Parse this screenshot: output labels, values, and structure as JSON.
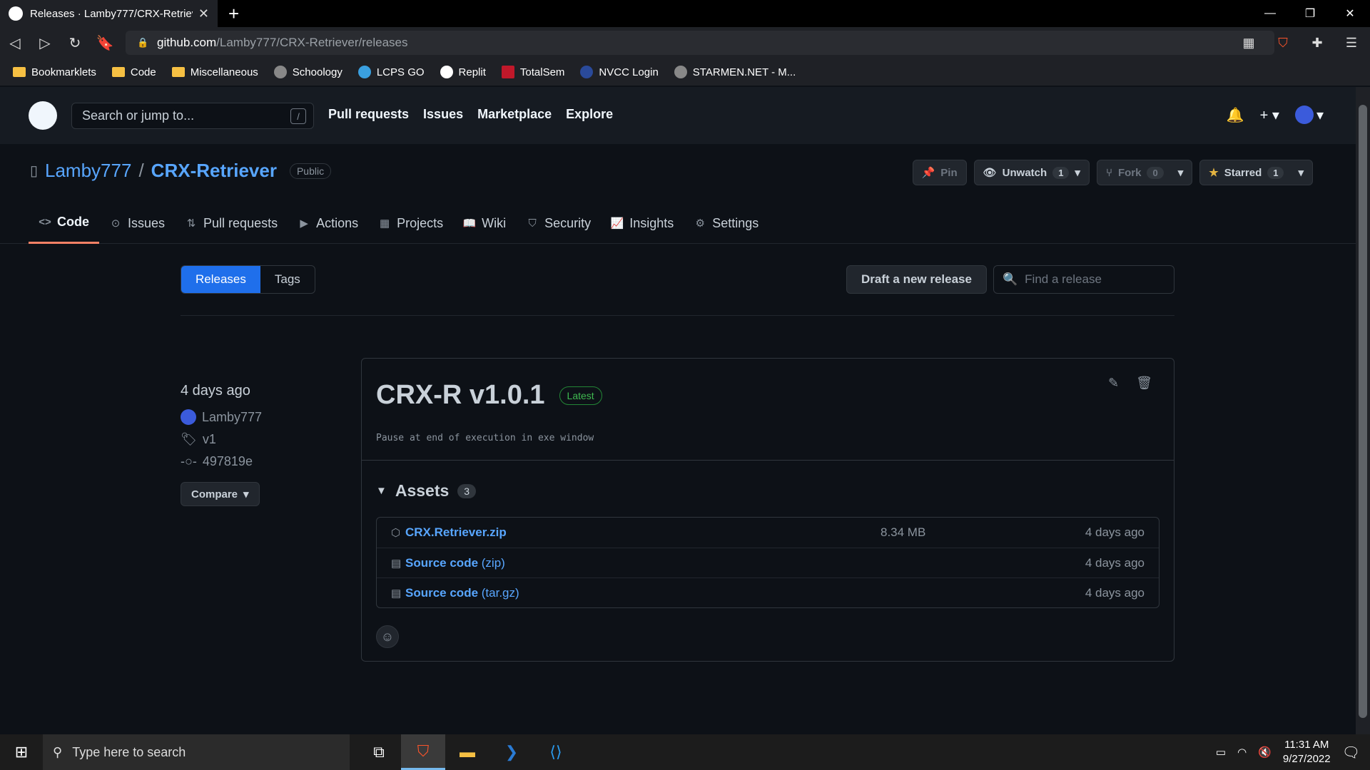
{
  "browser": {
    "tab_title": "Releases · Lamby777/CRX-Retriever",
    "url_host": "github.com",
    "url_path": "/Lamby777/CRX-Retriever/releases",
    "bookmarks": [
      "Bookmarklets",
      "Code",
      "Miscellaneous",
      "Schoology",
      "LCPS GO",
      "Replit",
      "TotalSem",
      "NVCC Login",
      "STARMEN.NET - M..."
    ]
  },
  "header": {
    "search_placeholder": "Search or jump to...",
    "slash": "/",
    "nav": [
      "Pull requests",
      "Issues",
      "Marketplace",
      "Explore"
    ]
  },
  "repo": {
    "owner": "Lamby777",
    "sep": "/",
    "name": "CRX-Retriever",
    "visibility": "Public",
    "pin": "Pin",
    "unwatch": "Unwatch",
    "unwatch_count": "1",
    "fork": "Fork",
    "fork_count": "0",
    "starred": "Starred",
    "star_count": "1",
    "tabs": [
      "Code",
      "Issues",
      "Pull requests",
      "Actions",
      "Projects",
      "Wiki",
      "Security",
      "Insights",
      "Settings"
    ]
  },
  "releases": {
    "seg_releases": "Releases",
    "seg_tags": "Tags",
    "draft": "Draft a new release",
    "find_placeholder": "Find a release",
    "ago": "4 days ago",
    "author": "Lamby777",
    "tag": "v1",
    "commit": "497819e",
    "compare": "Compare",
    "title": "CRX-R v1.0.1",
    "latest": "Latest",
    "note": "Pause at end of execution in exe window",
    "assets_label": "Assets",
    "assets_count": "3",
    "assets": [
      {
        "name": "CRX.Retriever.zip",
        "sub": "",
        "size": "8.34 MB",
        "date": "4 days ago"
      },
      {
        "name": "Source code",
        "sub": " (zip)",
        "size": "",
        "date": "4 days ago"
      },
      {
        "name": "Source code",
        "sub": " (tar.gz)",
        "size": "",
        "date": "4 days ago"
      }
    ]
  },
  "taskbar": {
    "search_placeholder": "Type here to search",
    "time": "11:31 AM",
    "date": "9/27/2022"
  }
}
